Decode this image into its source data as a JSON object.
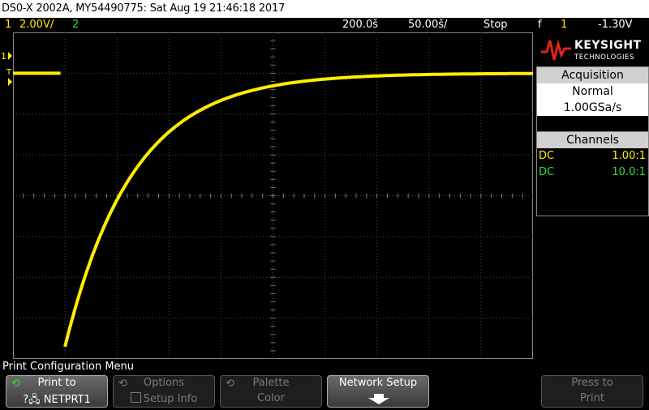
{
  "title_bar": "DS0-X 2002A, MY54490775: Sat Aug 19 21:46:18 2017",
  "status": {
    "ch1_num": "1",
    "ch1_scale": "2.00V/",
    "ch2_num": "2",
    "timebase": "200.0š",
    "delay": "50.00š/",
    "run_state": "Stop",
    "trigger_icon": "f",
    "trigger_channel": "1",
    "trigger_level": "-1.30V"
  },
  "markers": {
    "ch1_ground": "1",
    "trigger_marker": "T"
  },
  "logo": {
    "brand": "KEYSIGHT",
    "sub": "TECHNOLOGIES"
  },
  "acquisition": {
    "header": "Acquisition",
    "mode": "Normal",
    "rate": "1.00GSa/s"
  },
  "channels": {
    "header": "Channels",
    "rows": [
      {
        "coupling": "DC",
        "probe": "1.00:1",
        "color": "#ffee00"
      },
      {
        "coupling": "DC",
        "probe": "10.0:1",
        "color": "#33dd33"
      }
    ]
  },
  "menu": {
    "title": "Print Configuration Menu",
    "softkeys": [
      {
        "line1": "Print to",
        "line2": "NETPRT1",
        "icon": "refresh-icon",
        "icon2": "network-icon",
        "active": true
      },
      {
        "line1": "Options",
        "line2": "Setup Info",
        "icon": "refresh-icon",
        "active": false
      },
      {
        "line1": "Palette",
        "line2": "Color",
        "icon": "refresh-icon",
        "active": false
      },
      {
        "line1": "Network Setup",
        "line2": "",
        "icon": "arrow-down-icon",
        "active": true
      },
      {
        "line1": "Press to",
        "line2": "Print",
        "active": false
      }
    ]
  },
  "colors": {
    "ch1": "#ffee00",
    "ch2": "#33dd33",
    "trigger_marker": "#ff9900",
    "logo_red": "#e2231a",
    "graticule": "#4a4a4a"
  },
  "waveform": {
    "description_shape": "exponential rise",
    "start_divs_y": -3.7,
    "end_divs_y": 3.0,
    "pre_trigger_level_divs_y": 3.0,
    "rise_start_div_x": -5.0,
    "time_constant_divs": 1.3
  }
}
